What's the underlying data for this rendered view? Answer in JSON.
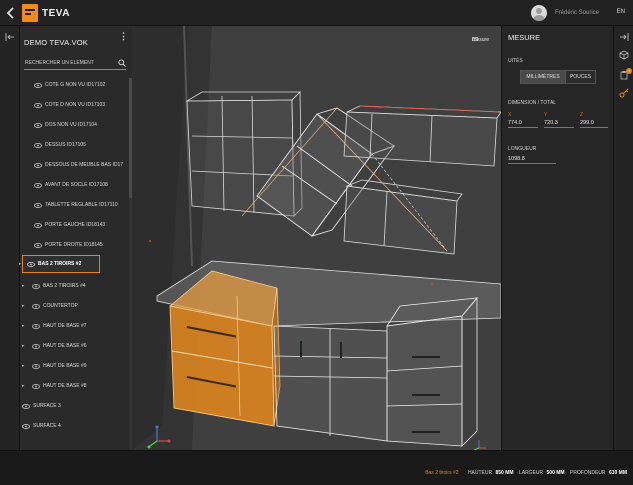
{
  "app": {
    "logo_text": "TEVA"
  },
  "header": {
    "user_name": "Frédéric Sourice",
    "language": "EN"
  },
  "left_panel": {
    "title": "DEMO TEVA.VOK",
    "search_placeholder": "RECHERCHER UN ÉLÉMENT",
    "items": [
      {
        "label": "CÔTÉ G NON VU ID17102",
        "level": "child"
      },
      {
        "label": "CÔTÉ D NON VU ID17103",
        "level": "child"
      },
      {
        "label": "DOS NON VU ID17104",
        "level": "child"
      },
      {
        "label": "DESSUS ID17105",
        "level": "child"
      },
      {
        "label": "DESSOUS DE MEUBLE BAS ID17",
        "level": "child"
      },
      {
        "label": "AVANT DE SOCLE ID17108",
        "level": "child"
      },
      {
        "label": "TABLETTE RÉGLABLE ID17110",
        "level": "child"
      },
      {
        "label": "PORTE GAUCHE ID18143",
        "level": "child"
      },
      {
        "label": "PORTE DROITE ID18145",
        "level": "child"
      },
      {
        "label": "BAS 2 TIROIRS #2",
        "level": "root",
        "selected": true
      },
      {
        "label": "BAS 2 TIROIRS #4",
        "level": "root"
      },
      {
        "label": "COUNTERTOP",
        "level": "root"
      },
      {
        "label": "HAUT DE BASE #7",
        "level": "root"
      },
      {
        "label": "HAUT DE BASE #6",
        "level": "root"
      },
      {
        "label": "HAUT DE BASE #9",
        "level": "root"
      },
      {
        "label": "HAUT DE BASE #8",
        "level": "root"
      },
      {
        "label": "SURFACE 3",
        "level": "root-nocaret"
      },
      {
        "label": "SURFACE 4",
        "level": "root-nocaret"
      }
    ]
  },
  "viewport": {
    "tool_label": "mesure"
  },
  "right_panel": {
    "title": "MESURE",
    "units_label": "UITÉS",
    "unit_options": [
      "MILLIMÈTRES",
      "POUCES"
    ],
    "selected_unit": "MILLIMÈTRES",
    "dimension_label": "DIMENSION / TOTAL",
    "axes": [
      {
        "axis": "X",
        "value": "774.0"
      },
      {
        "axis": "Y",
        "value": "720.3"
      },
      {
        "axis": "Z",
        "value": "299.0"
      }
    ],
    "length_label": "LONGUEUR",
    "length_value": "1098.8"
  },
  "status_bar": {
    "selected": "Bas 2 tiroirs #2",
    "hauteur_label": "HAUTEUR",
    "hauteur_value": "850 MM",
    "largeur_label": "LARGEUR",
    "largeur_value": "500 MM",
    "profondeur_label": "PROFONDEUR",
    "profondeur_value": "610 MM"
  },
  "icons": {
    "back": "chevron-left-icon",
    "panel_collapse": "collapse-left-icon",
    "panel_expand": "collapse-right-icon",
    "search": "search-icon",
    "visibility": "eye-icon",
    "cube": "cube-icon",
    "clipboard": "clipboard-icon",
    "key": "key-icon"
  },
  "colors": {
    "accent": "#e0861d",
    "selection_fill": "#f0901e"
  }
}
